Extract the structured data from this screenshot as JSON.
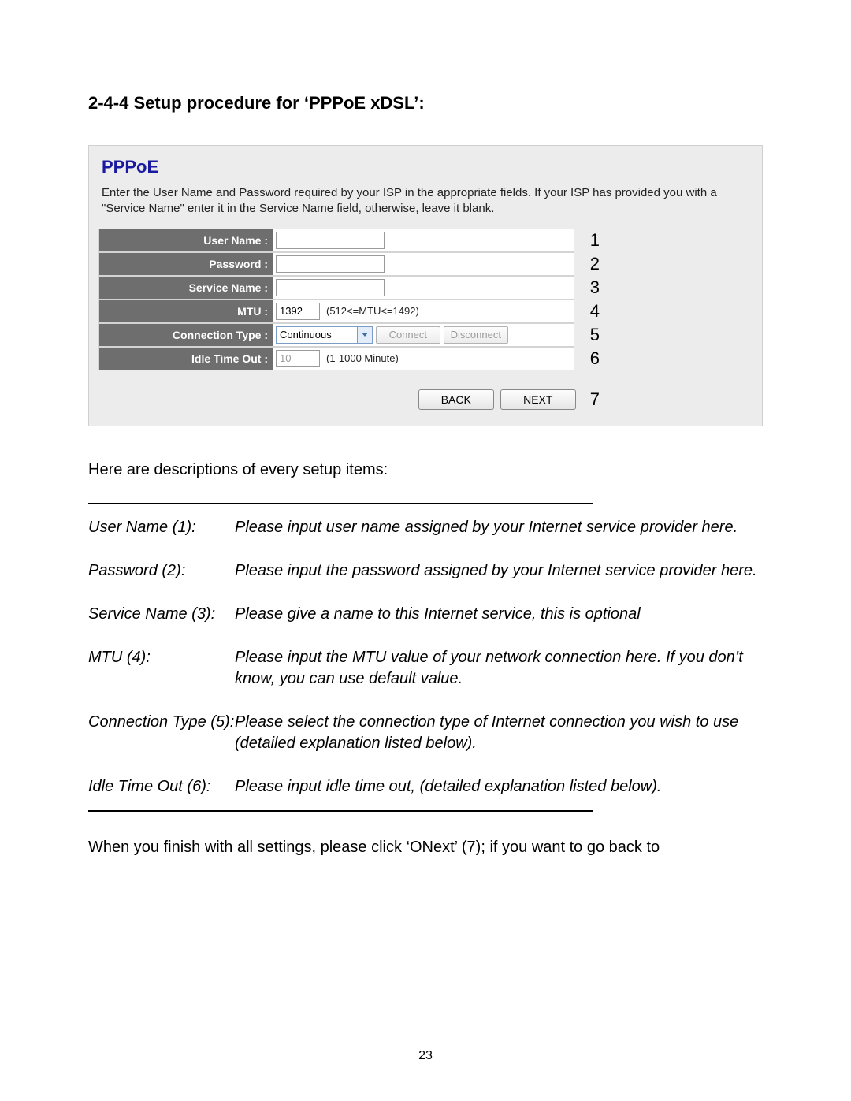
{
  "heading": "2-4-4 Setup procedure for ‘PPPoE xDSL’:",
  "panel": {
    "title": "PPPoE",
    "description": "Enter the User Name and Password required by your ISP in the appropriate fields. If your ISP has provided you with a \"Service Name\" enter it in the Service Name field, otherwise, leave it blank.",
    "rows": {
      "username": {
        "label": "User Name :",
        "value": "",
        "num": "1"
      },
      "password": {
        "label": "Password :",
        "value": "",
        "num": "2"
      },
      "service": {
        "label": "Service Name :",
        "value": "",
        "num": "3"
      },
      "mtu": {
        "label": "MTU :",
        "value": "1392",
        "hint": "(512<=MTU<=1492)",
        "num": "4"
      },
      "conntype": {
        "label": "Connection Type :",
        "selected": "Continuous",
        "connect_label": "Connect",
        "disconnect_label": "Disconnect",
        "num": "5"
      },
      "idle": {
        "label": "Idle Time Out :",
        "value": "10",
        "hint": "(1-1000 Minute)",
        "num": "6"
      }
    },
    "buttons": {
      "back": "BACK",
      "next": "NEXT",
      "num": "7"
    }
  },
  "descriptions_intro": "Here are descriptions of every setup items:",
  "definitions": [
    {
      "term": "User Name (1):",
      "text": "Please input user name assigned by your Internet service provider here."
    },
    {
      "term": "Password (2):",
      "text": "Please input the password assigned by your Internet service provider here."
    },
    {
      "term": "Service Name (3):",
      "text": "Please give a name to this Internet service, this is optional"
    },
    {
      "term": "MTU (4):",
      "text": "Please input the MTU value of your network connection here. If you don’t know, you can use default value."
    },
    {
      "term": "Connection Type (5):",
      "text": "Please select the connection type of Internet connection you wish to use (detailed explanation listed below)."
    },
    {
      "term": "Idle Time Out (6):",
      "text": "Please input idle time out, (detailed explanation listed below)."
    }
  ],
  "closing": "When you finish with all settings, please click ‘ONext’ (7); if you want to go back to",
  "page_number": "23"
}
